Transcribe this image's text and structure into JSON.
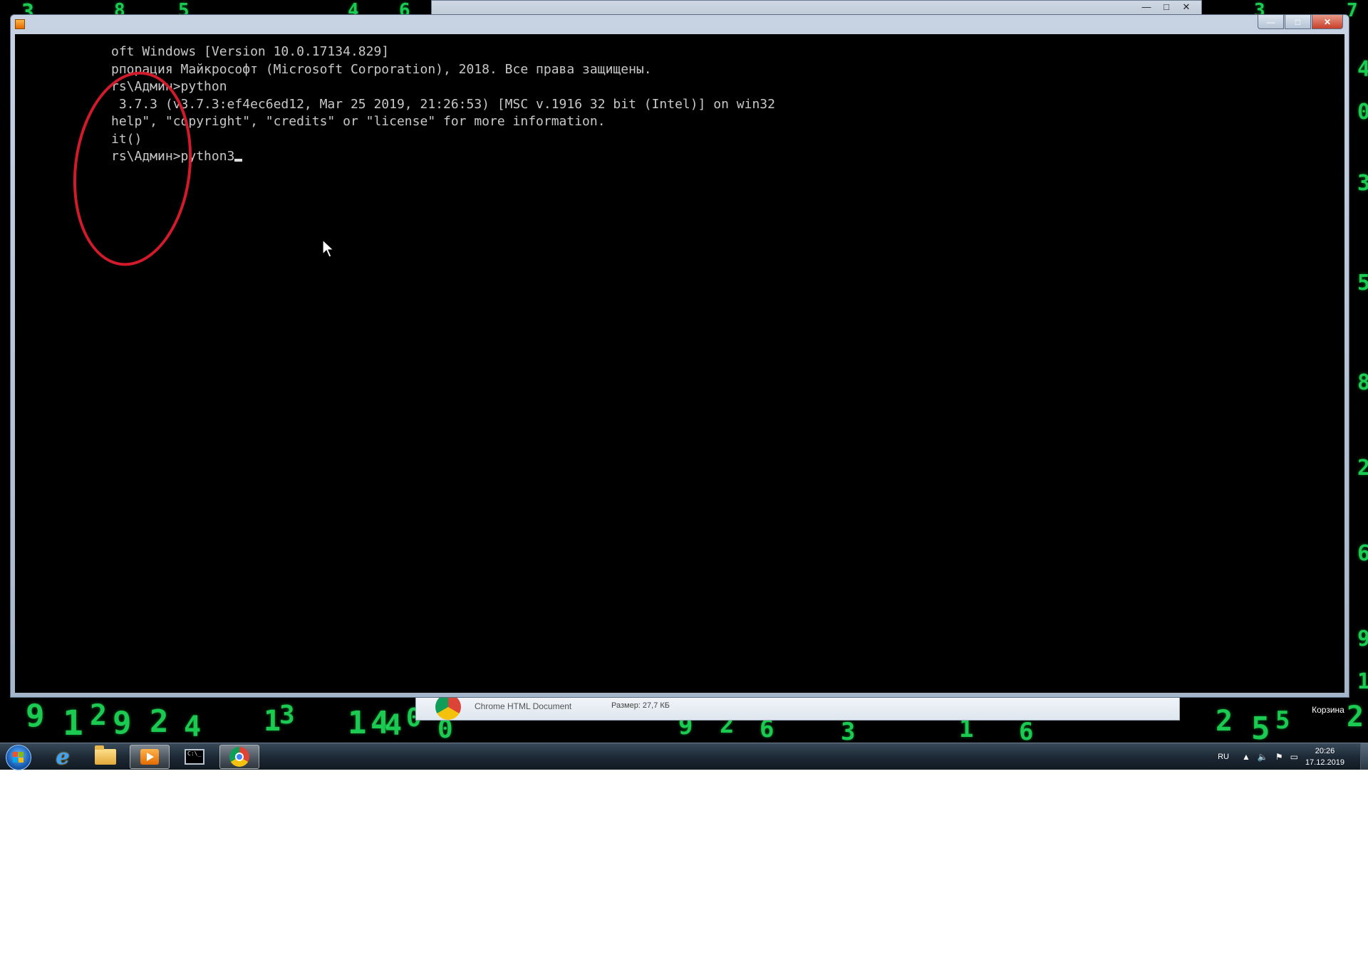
{
  "console": {
    "lines": [
      "oft Windows [Version 10.0.17134.829]",
      "рпорация Майкрософт (Microsoft Corporation), 2018. Все права защищены.",
      "",
      "rs\\Админ>python",
      " 3.7.3 (v3.7.3:ef4ec6ed12, Mar 25 2019, 21:26:53) [MSC v.1916 32 bit (Intel)] on win32",
      "help\", \"copyright\", \"credits\" or \"license\" for more information.",
      "it()",
      "",
      "rs\\Админ>python3"
    ],
    "window_controls": {
      "minimize": "—",
      "maximize": "□",
      "close": "✕"
    }
  },
  "download_bar": {
    "file_type": "Chrome HTML Document",
    "size": "Размер: 27,7 КБ"
  },
  "desktop": {
    "recycle_bin_label": "Корзина",
    "digits": [
      "9",
      "1",
      "2",
      "9",
      "2",
      "4",
      "1",
      "3",
      "1",
      "4",
      "4",
      "0",
      "0",
      "9",
      "2",
      "6",
      "3",
      "1",
      "6",
      "2",
      "5",
      "5",
      "2",
      "3",
      "8",
      "5",
      "4",
      "6",
      "4",
      "6",
      "5",
      "1",
      "2",
      "3",
      "7",
      "4",
      "0",
      "3",
      "5",
      "8",
      "2",
      "6"
    ]
  },
  "taskbar": {
    "items": [
      {
        "name": "internet-explorer",
        "icon": "ie-icon"
      },
      {
        "name": "file-explorer",
        "icon": "folder-icon"
      },
      {
        "name": "media-player",
        "icon": "media-player-icon"
      },
      {
        "name": "command-prompt",
        "icon": "cmd-icon"
      },
      {
        "name": "chrome",
        "icon": "chrome-icon"
      }
    ],
    "language": "RU",
    "time": "20:26",
    "date": "17.12.2019"
  },
  "colors": {
    "matrix_green": "#1fe05a",
    "annotation_red": "#d21a2a",
    "console_text": "#c8c8c8"
  }
}
